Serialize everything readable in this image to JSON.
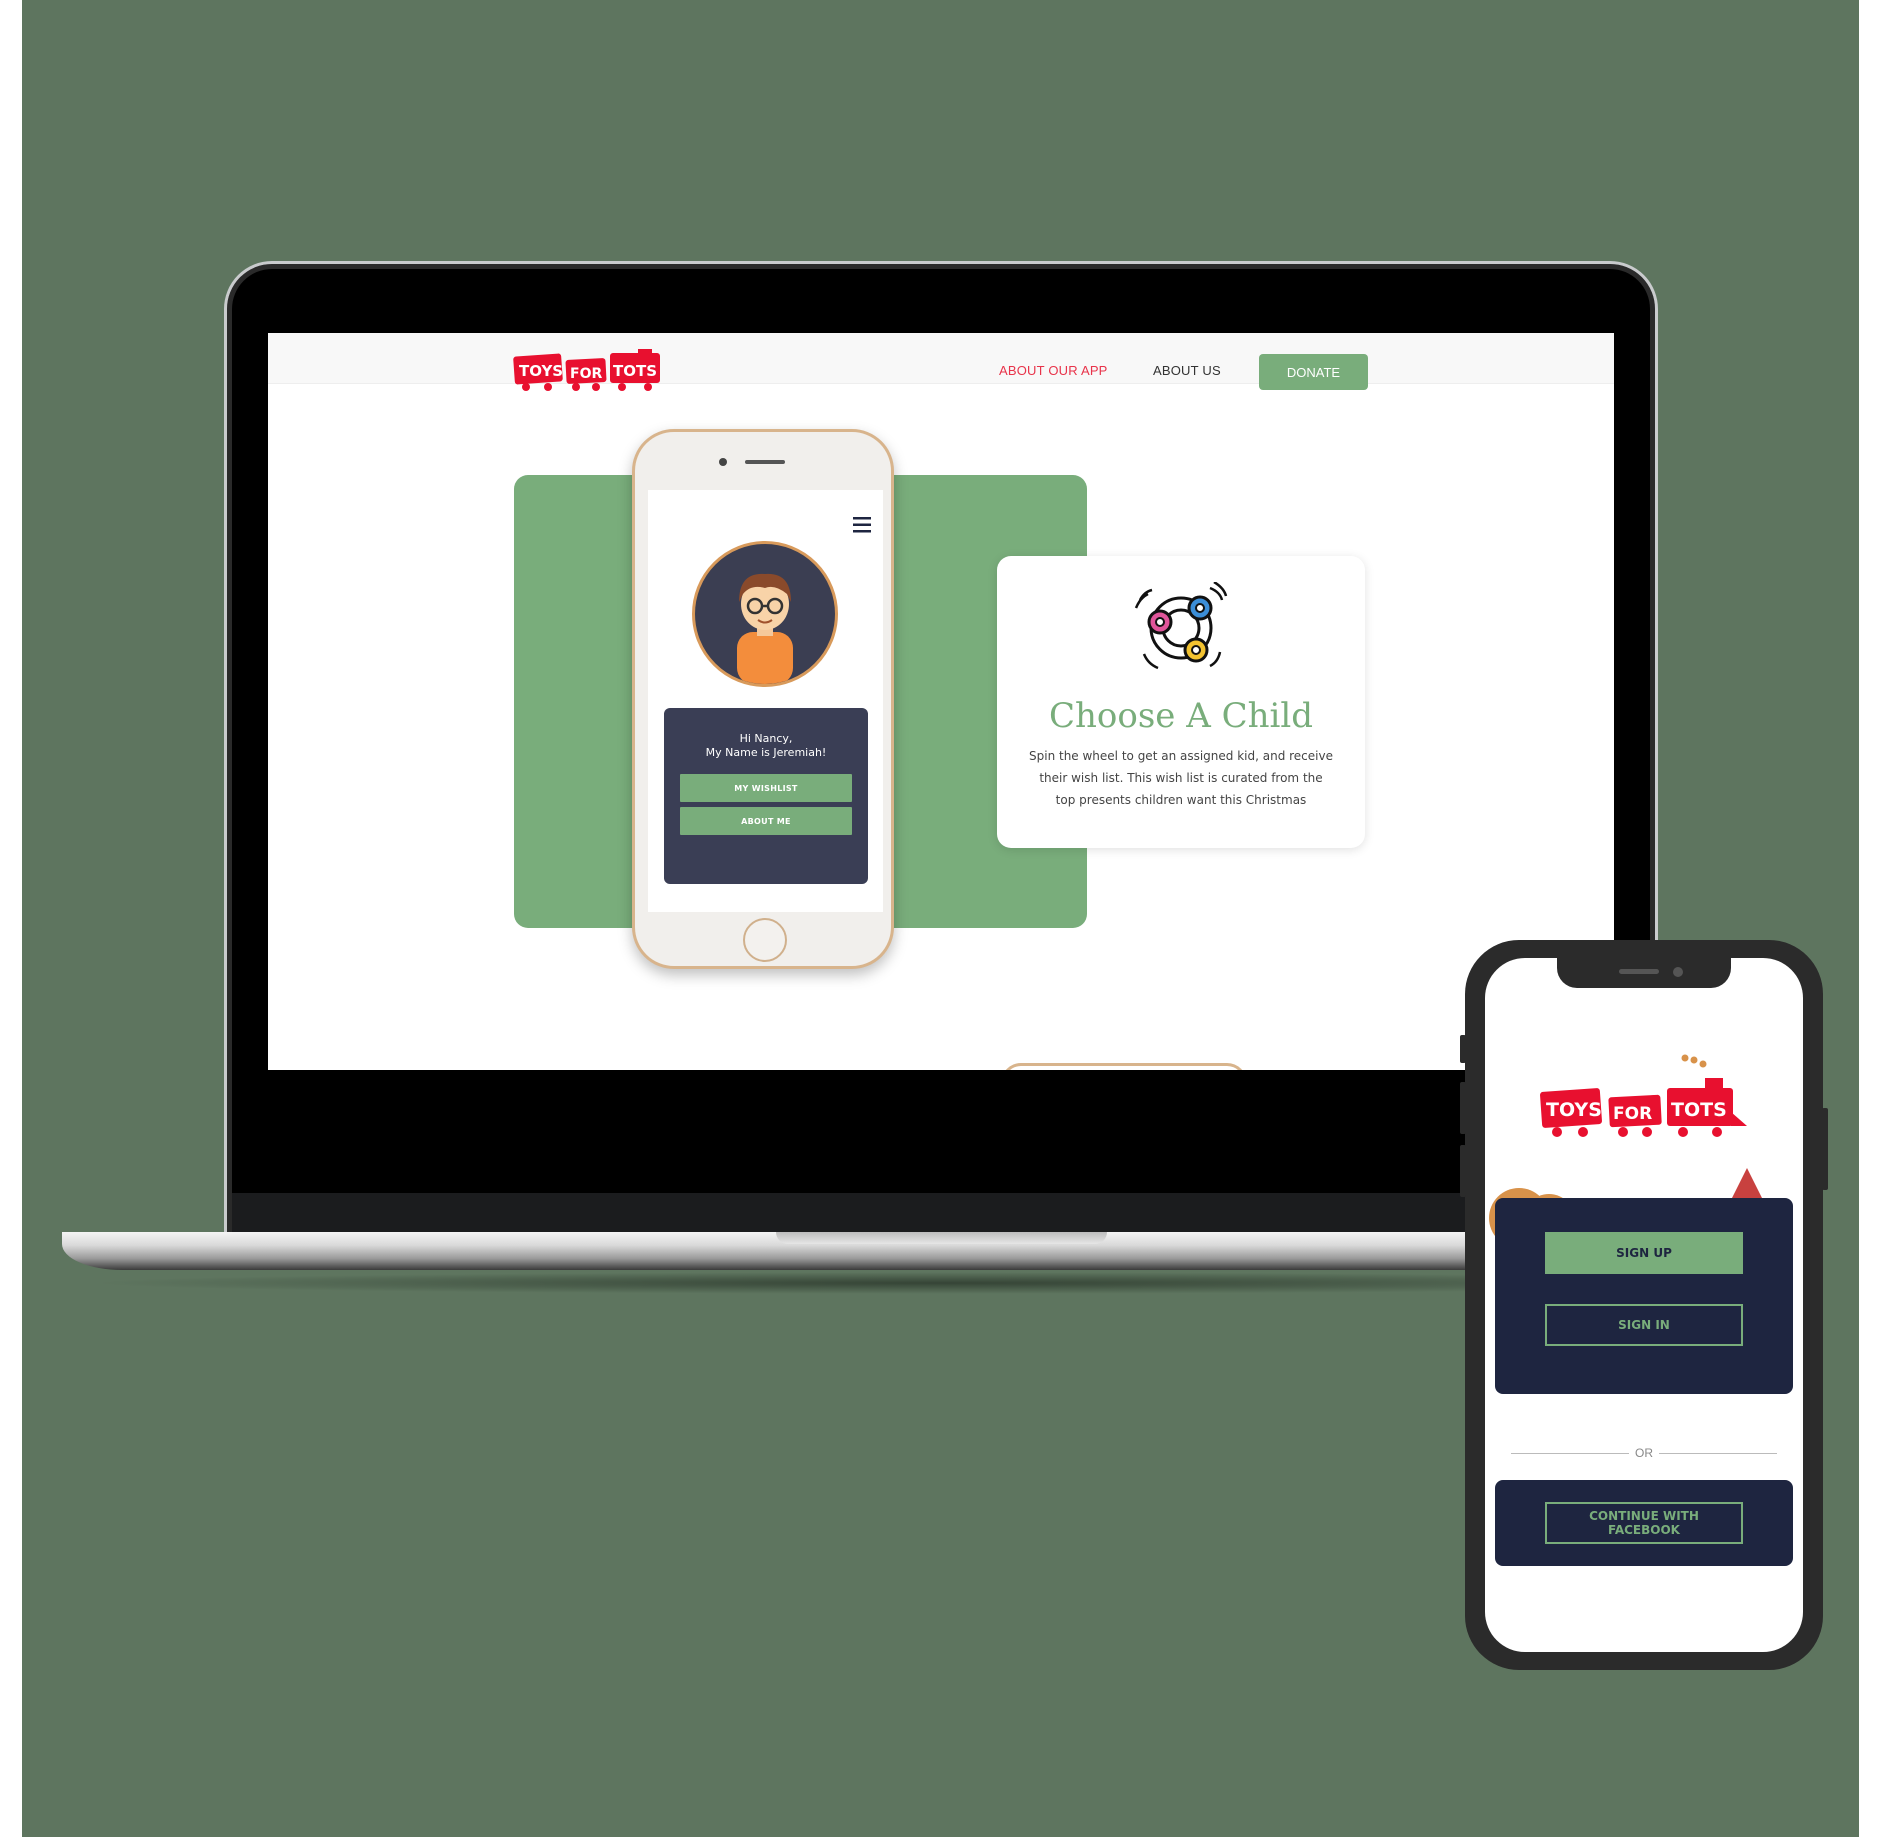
{
  "brand": {
    "logo_text": [
      "TOYS",
      "FOR",
      "TOTS"
    ],
    "logo_color": "#e8102f",
    "accent_green": "#79ad7b",
    "navy": "#1e2540",
    "background": "#5e755f"
  },
  "desktop": {
    "nav": {
      "about_app": "ABOUT OUR APP",
      "about_us": "ABOUT US",
      "donate": "DONATE"
    },
    "mockup": {
      "menu_icon": "hamburger-menu-icon",
      "greeting_line1": "Hi Nancy,",
      "greeting_line2": "My Name is Jeremiah!",
      "wishlist_button": "MY WISHLIST",
      "about_button": "ABOUT ME"
    },
    "feature": {
      "icon": "spinner-wheel-icon",
      "title": "Choose A Child",
      "description": "Spin the wheel to get an assigned kid, and receive their wish list. This wish list is curated from the top presents children want this Christmas"
    }
  },
  "mobile": {
    "sign_up": "SIGN UP",
    "sign_in": "SIGN IN",
    "or": "OR",
    "facebook": "CONTINUE WITH FACEBOOK"
  }
}
